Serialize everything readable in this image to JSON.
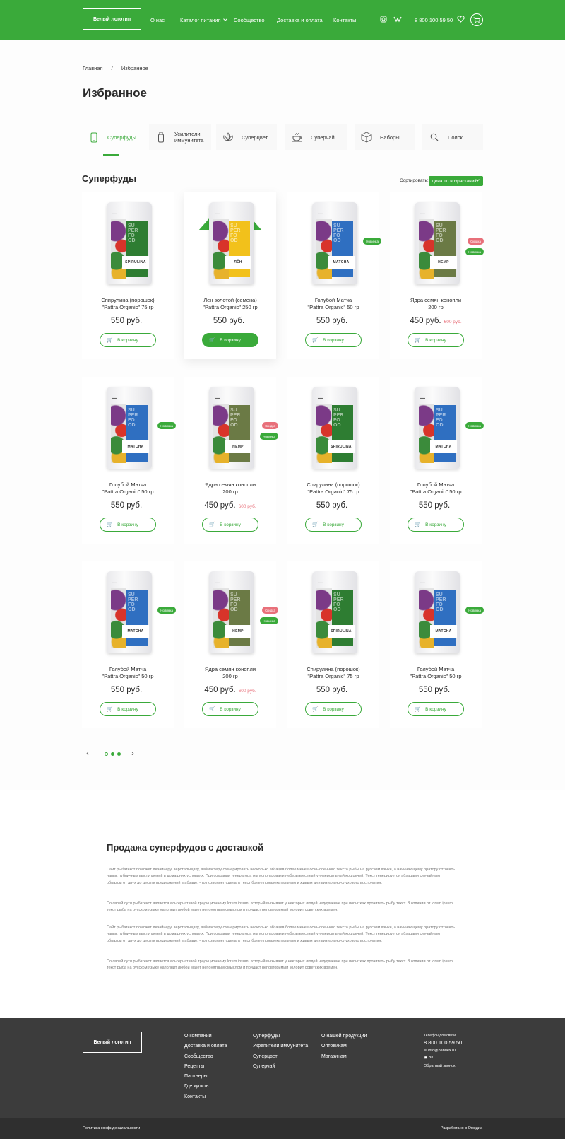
{
  "header": {
    "logo": "Белый логотип",
    "nav": [
      {
        "label": "О нас"
      },
      {
        "label": "Каталог питания"
      },
      {
        "label": "Сообщество"
      },
      {
        "label": "Доставка и оплата"
      },
      {
        "label": "Контакты"
      }
    ],
    "phone": "8 800 100 59 50"
  },
  "breadcrumb": {
    "home": "Главная",
    "sep": "/",
    "current": "Избранное"
  },
  "page_title": "Избранное",
  "tabs": [
    {
      "label": "Суперфуды",
      "icon": "phone-icon"
    },
    {
      "label": "Усилители иммунитета",
      "icon": "bottle-icon"
    },
    {
      "label": "Суперцвет",
      "icon": "flower-icon"
    },
    {
      "label": "Суперчай",
      "icon": "cup-icon"
    },
    {
      "label": "Наборы",
      "icon": "box-icon"
    },
    {
      "label": "Поиск",
      "icon": "search-icon"
    }
  ],
  "section": {
    "title": "Суперфуды",
    "sort_label": "Сортировать:",
    "sort_value": "цена по возрастанию"
  },
  "products": [
    {
      "name1": "Спирулина (порошок)",
      "name2": "\"Pattra Organic\" 75 гр",
      "price": "550 руб.",
      "old": "",
      "badges": [],
      "label": "SPIRULINA",
      "panel": "#2e7d32",
      "btn": "В корзину"
    },
    {
      "name1": "Лен золотой (семена)",
      "name2": "\"Pattra Organic\" 250 гр",
      "price": "550 руб.",
      "old": "",
      "badges": [],
      "label": "ЛЁН",
      "panel": "#f2c11b",
      "btn": "В корзину"
    },
    {
      "name1": "Голубой Матча",
      "name2": "\"Pattra Organic\" 50 гр",
      "price": "550 руб.",
      "old": "",
      "badges": [
        "Новинка"
      ],
      "label": "MATCHA",
      "panel": "#2f6fc1",
      "btn": "В корзину"
    },
    {
      "name1": "Ядра семян конопли",
      "name2": "200 гр",
      "price": "450 руб.",
      "old": "600 руб.",
      "badges": [
        "Скидка",
        "Новинка"
      ],
      "label": "HEMP",
      "panel": "#6b7a45",
      "btn": "В корзину"
    },
    {
      "name1": "Голубой Матча",
      "name2": "\"Pattra Organic\" 50 гр",
      "price": "550 руб.",
      "old": "",
      "badges": [
        "Новинка"
      ],
      "label": "MATCHA",
      "panel": "#2f6fc1",
      "btn": "В корзину"
    },
    {
      "name1": "Ядра семян конопли",
      "name2": "200 гр",
      "price": "450 руб.",
      "old": "600 руб.",
      "badges": [
        "Скидка",
        "Новинка"
      ],
      "label": "HEMP",
      "panel": "#6b7a45",
      "btn": "В корзину"
    },
    {
      "name1": "Спирулина (порошок)",
      "name2": "\"Pattra Organic\" 75 гр",
      "price": "550 руб.",
      "old": "",
      "badges": [],
      "label": "SPIRULINA",
      "panel": "#2e7d32",
      "btn": "В корзину"
    },
    {
      "name1": "Голубой Матча",
      "name2": "\"Pattra Organic\" 50 гр",
      "price": "550 руб.",
      "old": "",
      "badges": [
        "Новинка"
      ],
      "label": "MATCHA",
      "panel": "#2f6fc1",
      "btn": "В корзину"
    },
    {
      "name1": "Голубой Матча",
      "name2": "\"Pattra Organic\" 50 гр",
      "price": "550 руб.",
      "old": "",
      "badges": [
        "Новинка"
      ],
      "label": "MATCHA",
      "panel": "#2f6fc1",
      "btn": "В корзину"
    },
    {
      "name1": "Ядра семян конопли",
      "name2": "200 гр",
      "price": "450 руб.",
      "old": "600 руб.",
      "badges": [
        "Скидка",
        "Новинка"
      ],
      "label": "HEMP",
      "panel": "#6b7a45",
      "btn": "В корзину"
    },
    {
      "name1": "Спирулина (порошок)",
      "name2": "\"Pattra Organic\" 75 гр",
      "price": "550 руб.",
      "old": "",
      "badges": [],
      "label": "SPIRULINA",
      "panel": "#2e7d32",
      "btn": "В корзину"
    },
    {
      "name1": "Голубой Матча",
      "name2": "\"Pattra Organic\" 50 гр",
      "price": "550 руб.",
      "old": "",
      "badges": [
        "Новинка"
      ],
      "label": "MATCHA",
      "panel": "#2f6fc1",
      "btn": "В корзину"
    }
  ],
  "seo": {
    "title": "Продажа суперфудов с доставкой",
    "p1": "Сайт рыбатекст поможет дизайнеру, верстальщику, вебмастеру сгенерировать несколько абзацев более менее осмысленного текста рыбы на русском языке, а начинающему оратору отточить навык публичных выступлений в домашних условиях. При создании генератора мы использовали небезызвестный универсальный код речей. Текст генерируется абзацами случайным образом от двух до десяти предложений в абзаце, что позволяет сделать текст более привлекательным и живым для визуально-слухового восприятия.",
    "p2": "По своей сути рыбатекст является альтернативой традиционному lorem ipsum, который вызывает у некторых людей недоумение при попытках прочитать рыбу текст. В отличии от lorem ipsum, текст рыба на русском языке наполнит любой макет непонятным смыслом и придаст неповторимый колорит советских времен.",
    "p3": "Сайт рыбатекст поможет дизайнеру, верстальщику, вебмастеру сгенерировать несколько абзацев более менее осмысленного текста рыбы на русском языке, а начинающему оратору отточить навык публичных выступлений в домашних условиях. При создании генератора мы использовали небезызвестный универсальный код речей. Текст генерируется абзацами случайным образом от двух до десяти предложений в абзаце, что позволяет сделать текст более привлекательным и живым для визуально-слухового восприятия.",
    "p4": "По своей сути рыбатекст является альтернативой традиционному lorem ipsum, который вызывает у некторых людей недоумение при попытках прочитать рыбу текст. В отличии от lorem ipsum, текст рыба на русском языке наполнит любой макет непонятным смыслом и придаст неповторимый колорит советских времен."
  },
  "footer": {
    "logo": "Белый логотип",
    "col1": [
      "О компании",
      "Доставка и оплата",
      "Сообщество",
      "Рецепты",
      "Партнеры",
      "Где купить",
      "Контакты"
    ],
    "col2": [
      "Суперфуды",
      "Укрепители иммунитета",
      "Суперцвет",
      "Суперчай"
    ],
    "col3": [
      "О нашей продукции",
      "Оптовикам",
      "Магазинам"
    ],
    "contact_label": "Телефон для связи:",
    "phone": "8 800 100 59 50",
    "email": "info@pandex.ru",
    "social": "ВК",
    "callback": "Обратный звонок",
    "policy": "Политика конфиденциальности",
    "dev": "Разработано в Омедиа"
  },
  "colors": {
    "brand": "#3aaa3a",
    "sale": "#e8707a",
    "footer": "#3c3c3c"
  }
}
